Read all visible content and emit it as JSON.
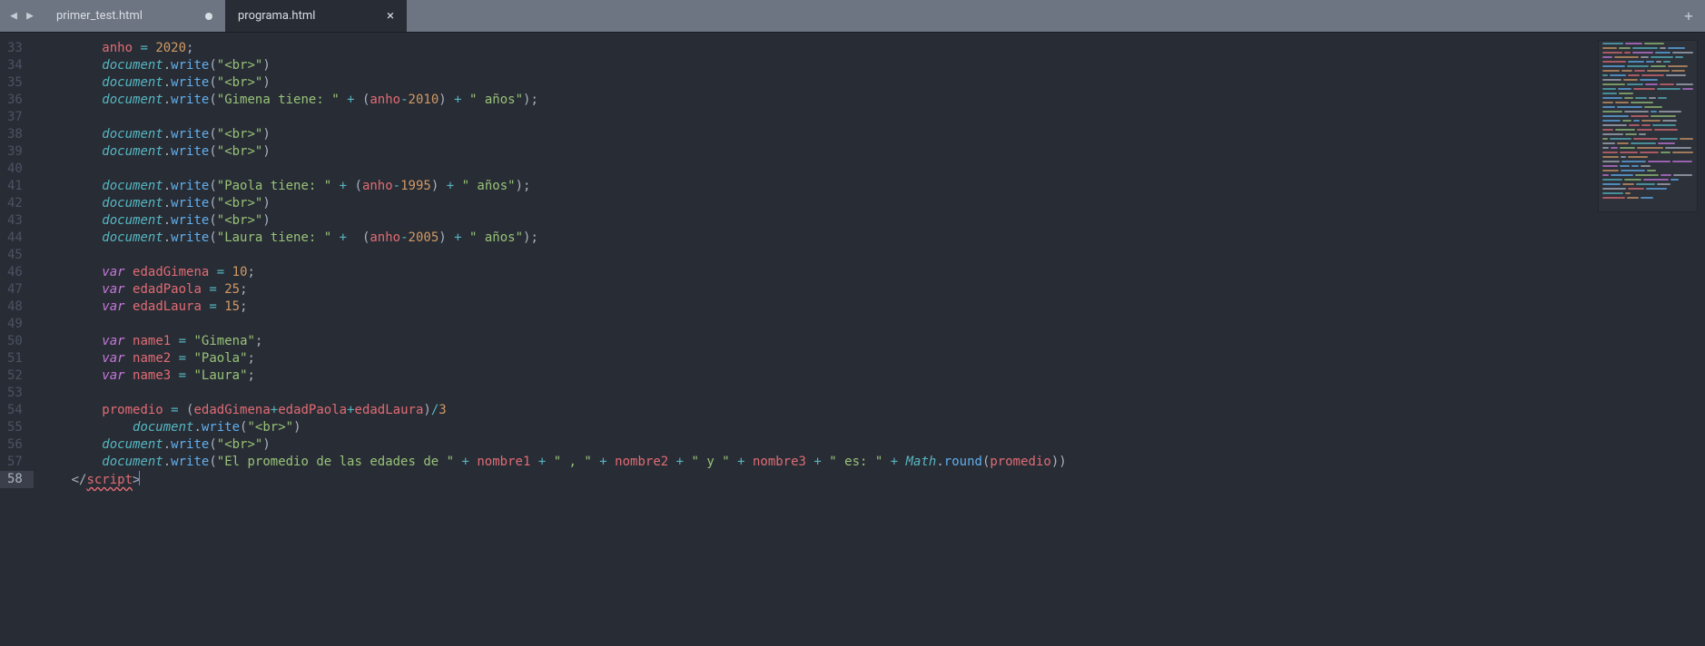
{
  "tabs": {
    "nav_prev": "◀",
    "nav_next": "▶",
    "items": [
      {
        "label": "primer_test.html",
        "active": false,
        "dirty": true
      },
      {
        "label": "programa.html",
        "active": true,
        "dirty": false
      }
    ],
    "add_label": "+"
  },
  "editor": {
    "first_line": 33,
    "active_line": 58,
    "lines": [
      {
        "n": 33,
        "indent": 8,
        "tokens": [
          [
            "var",
            "anho"
          ],
          [
            "plain",
            " "
          ],
          [
            "op",
            "="
          ],
          [
            "plain",
            " "
          ],
          [
            "num",
            "2020"
          ],
          [
            "punc",
            ";"
          ]
        ]
      },
      {
        "n": 34,
        "indent": 8,
        "tokens": [
          [
            "doc",
            "document"
          ],
          [
            "punc",
            "."
          ],
          [
            "fn",
            "write"
          ],
          [
            "punc",
            "("
          ],
          [
            "str",
            "\"<br>\""
          ],
          [
            "punc",
            ")"
          ]
        ]
      },
      {
        "n": 35,
        "indent": 8,
        "tokens": [
          [
            "doc",
            "document"
          ],
          [
            "punc",
            "."
          ],
          [
            "fn",
            "write"
          ],
          [
            "punc",
            "("
          ],
          [
            "str",
            "\"<br>\""
          ],
          [
            "punc",
            ")"
          ]
        ]
      },
      {
        "n": 36,
        "indent": 8,
        "tokens": [
          [
            "doc",
            "document"
          ],
          [
            "punc",
            "."
          ],
          [
            "fn",
            "write"
          ],
          [
            "punc",
            "("
          ],
          [
            "str",
            "\"Gimena tiene: \""
          ],
          [
            "plain",
            " "
          ],
          [
            "op",
            "+"
          ],
          [
            "plain",
            " "
          ],
          [
            "punc",
            "("
          ],
          [
            "var",
            "anho"
          ],
          [
            "op",
            "-"
          ],
          [
            "num",
            "2010"
          ],
          [
            "punc",
            ")"
          ],
          [
            "plain",
            " "
          ],
          [
            "op",
            "+"
          ],
          [
            "plain",
            " "
          ],
          [
            "str",
            "\" años\""
          ],
          [
            "punc",
            ")"
          ],
          [
            "punc",
            ";"
          ]
        ]
      },
      {
        "n": 37,
        "indent": 0,
        "tokens": []
      },
      {
        "n": 38,
        "indent": 8,
        "tokens": [
          [
            "doc",
            "document"
          ],
          [
            "punc",
            "."
          ],
          [
            "fn",
            "write"
          ],
          [
            "punc",
            "("
          ],
          [
            "str",
            "\"<br>\""
          ],
          [
            "punc",
            ")"
          ]
        ]
      },
      {
        "n": 39,
        "indent": 8,
        "tokens": [
          [
            "doc",
            "document"
          ],
          [
            "punc",
            "."
          ],
          [
            "fn",
            "write"
          ],
          [
            "punc",
            "("
          ],
          [
            "str",
            "\"<br>\""
          ],
          [
            "punc",
            ")"
          ]
        ]
      },
      {
        "n": 40,
        "indent": 0,
        "tokens": []
      },
      {
        "n": 41,
        "indent": 8,
        "tokens": [
          [
            "doc",
            "document"
          ],
          [
            "punc",
            "."
          ],
          [
            "fn",
            "write"
          ],
          [
            "punc",
            "("
          ],
          [
            "str",
            "\"Paola tiene: \""
          ],
          [
            "plain",
            " "
          ],
          [
            "op",
            "+"
          ],
          [
            "plain",
            " "
          ],
          [
            "punc",
            "("
          ],
          [
            "var",
            "anho"
          ],
          [
            "op",
            "-"
          ],
          [
            "num",
            "1995"
          ],
          [
            "punc",
            ")"
          ],
          [
            "plain",
            " "
          ],
          [
            "op",
            "+"
          ],
          [
            "plain",
            " "
          ],
          [
            "str",
            "\" años\""
          ],
          [
            "punc",
            ")"
          ],
          [
            "punc",
            ";"
          ]
        ]
      },
      {
        "n": 42,
        "indent": 8,
        "tokens": [
          [
            "doc",
            "document"
          ],
          [
            "punc",
            "."
          ],
          [
            "fn",
            "write"
          ],
          [
            "punc",
            "("
          ],
          [
            "str",
            "\"<br>\""
          ],
          [
            "punc",
            ")"
          ]
        ]
      },
      {
        "n": 43,
        "indent": 8,
        "tokens": [
          [
            "doc",
            "document"
          ],
          [
            "punc",
            "."
          ],
          [
            "fn",
            "write"
          ],
          [
            "punc",
            "("
          ],
          [
            "str",
            "\"<br>\""
          ],
          [
            "punc",
            ")"
          ]
        ]
      },
      {
        "n": 44,
        "indent": 8,
        "tokens": [
          [
            "doc",
            "document"
          ],
          [
            "punc",
            "."
          ],
          [
            "fn",
            "write"
          ],
          [
            "punc",
            "("
          ],
          [
            "str",
            "\"Laura tiene: \""
          ],
          [
            "plain",
            " "
          ],
          [
            "op",
            "+"
          ],
          [
            "plain",
            "  "
          ],
          [
            "punc",
            "("
          ],
          [
            "var",
            "anho"
          ],
          [
            "op",
            "-"
          ],
          [
            "num",
            "2005"
          ],
          [
            "punc",
            ")"
          ],
          [
            "plain",
            " "
          ],
          [
            "op",
            "+"
          ],
          [
            "plain",
            " "
          ],
          [
            "str",
            "\" años\""
          ],
          [
            "punc",
            ")"
          ],
          [
            "punc",
            ";"
          ]
        ]
      },
      {
        "n": 45,
        "indent": 0,
        "tokens": []
      },
      {
        "n": 46,
        "indent": 8,
        "tokens": [
          [
            "key",
            "var"
          ],
          [
            "plain",
            " "
          ],
          [
            "var",
            "edadGimena"
          ],
          [
            "plain",
            " "
          ],
          [
            "op",
            "="
          ],
          [
            "plain",
            " "
          ],
          [
            "num",
            "10"
          ],
          [
            "punc",
            ";"
          ]
        ]
      },
      {
        "n": 47,
        "indent": 8,
        "tokens": [
          [
            "key",
            "var"
          ],
          [
            "plain",
            " "
          ],
          [
            "var",
            "edadPaola"
          ],
          [
            "plain",
            " "
          ],
          [
            "op",
            "="
          ],
          [
            "plain",
            " "
          ],
          [
            "num",
            "25"
          ],
          [
            "punc",
            ";"
          ]
        ]
      },
      {
        "n": 48,
        "indent": 8,
        "tokens": [
          [
            "key",
            "var"
          ],
          [
            "plain",
            " "
          ],
          [
            "var",
            "edadLaura"
          ],
          [
            "plain",
            " "
          ],
          [
            "op",
            "="
          ],
          [
            "plain",
            " "
          ],
          [
            "num",
            "15"
          ],
          [
            "punc",
            ";"
          ]
        ]
      },
      {
        "n": 49,
        "indent": 0,
        "tokens": []
      },
      {
        "n": 50,
        "indent": 8,
        "tokens": [
          [
            "key",
            "var"
          ],
          [
            "plain",
            " "
          ],
          [
            "var",
            "name1"
          ],
          [
            "plain",
            " "
          ],
          [
            "op",
            "="
          ],
          [
            "plain",
            " "
          ],
          [
            "str",
            "\"Gimena\""
          ],
          [
            "punc",
            ";"
          ]
        ]
      },
      {
        "n": 51,
        "indent": 8,
        "tokens": [
          [
            "key",
            "var"
          ],
          [
            "plain",
            " "
          ],
          [
            "var",
            "name2"
          ],
          [
            "plain",
            " "
          ],
          [
            "op",
            "="
          ],
          [
            "plain",
            " "
          ],
          [
            "str",
            "\"Paola\""
          ],
          [
            "punc",
            ";"
          ]
        ]
      },
      {
        "n": 52,
        "indent": 8,
        "tokens": [
          [
            "key",
            "var"
          ],
          [
            "plain",
            " "
          ],
          [
            "var",
            "name3"
          ],
          [
            "plain",
            " "
          ],
          [
            "op",
            "="
          ],
          [
            "plain",
            " "
          ],
          [
            "str",
            "\"Laura\""
          ],
          [
            "punc",
            ";"
          ]
        ]
      },
      {
        "n": 53,
        "indent": 0,
        "tokens": []
      },
      {
        "n": 54,
        "indent": 8,
        "tokens": [
          [
            "var",
            "promedio"
          ],
          [
            "plain",
            " "
          ],
          [
            "op",
            "="
          ],
          [
            "plain",
            " "
          ],
          [
            "punc",
            "("
          ],
          [
            "var",
            "edadGimena"
          ],
          [
            "op",
            "+"
          ],
          [
            "var",
            "edadPaola"
          ],
          [
            "op",
            "+"
          ],
          [
            "var",
            "edadLaura"
          ],
          [
            "punc",
            ")"
          ],
          [
            "op",
            "/"
          ],
          [
            "num",
            "3"
          ]
        ]
      },
      {
        "n": 55,
        "indent": 12,
        "tokens": [
          [
            "doc",
            "document"
          ],
          [
            "punc",
            "."
          ],
          [
            "fn",
            "write"
          ],
          [
            "punc",
            "("
          ],
          [
            "str",
            "\"<br>\""
          ],
          [
            "punc",
            ")"
          ]
        ]
      },
      {
        "n": 56,
        "indent": 8,
        "tokens": [
          [
            "doc",
            "document"
          ],
          [
            "punc",
            "."
          ],
          [
            "fn",
            "write"
          ],
          [
            "punc",
            "("
          ],
          [
            "str",
            "\"<br>\""
          ],
          [
            "punc",
            ")"
          ]
        ]
      },
      {
        "n": 57,
        "indent": 8,
        "tokens": [
          [
            "doc",
            "document"
          ],
          [
            "punc",
            "."
          ],
          [
            "fn",
            "write"
          ],
          [
            "punc",
            "("
          ],
          [
            "str",
            "\"El promedio de las edades de \""
          ],
          [
            "plain",
            " "
          ],
          [
            "op",
            "+"
          ],
          [
            "plain",
            " "
          ],
          [
            "var",
            "nombre1"
          ],
          [
            "plain",
            " "
          ],
          [
            "op",
            "+"
          ],
          [
            "plain",
            " "
          ],
          [
            "str",
            "\" , \""
          ],
          [
            "plain",
            " "
          ],
          [
            "op",
            "+"
          ],
          [
            "plain",
            " "
          ],
          [
            "var",
            "nombre2"
          ],
          [
            "plain",
            " "
          ],
          [
            "op",
            "+"
          ],
          [
            "plain",
            " "
          ],
          [
            "str",
            "\" y \""
          ],
          [
            "plain",
            " "
          ],
          [
            "op",
            "+"
          ],
          [
            "plain",
            " "
          ],
          [
            "var",
            "nombre3"
          ],
          [
            "plain",
            " "
          ],
          [
            "op",
            "+"
          ],
          [
            "plain",
            " "
          ],
          [
            "str",
            "\" es: \""
          ],
          [
            "plain",
            " "
          ],
          [
            "op",
            "+"
          ],
          [
            "plain",
            " "
          ],
          [
            "doc",
            "Math"
          ],
          [
            "punc",
            "."
          ],
          [
            "fn",
            "round"
          ],
          [
            "punc",
            "("
          ],
          [
            "var",
            "promedio"
          ],
          [
            "punc",
            ")"
          ],
          [
            "punc",
            ")"
          ]
        ]
      },
      {
        "n": 58,
        "indent": 4,
        "tokens": [
          [
            "punc",
            "</"
          ],
          [
            "err",
            "script"
          ],
          [
            "punc",
            ">"
          ],
          [
            "cursor",
            ""
          ]
        ]
      }
    ]
  }
}
